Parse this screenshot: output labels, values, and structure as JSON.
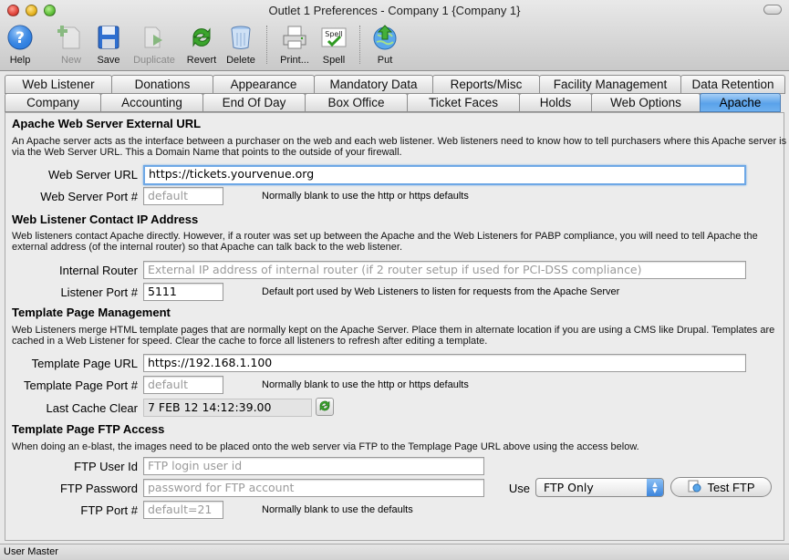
{
  "window": {
    "title": "Outlet 1 Preferences - Company 1 {Company 1}"
  },
  "toolbar": {
    "help": "Help",
    "new": "New",
    "save": "Save",
    "duplicate": "Duplicate",
    "revert": "Revert",
    "delete": "Delete",
    "print": "Print...",
    "spell": "Spell",
    "spell_icon_text": "Spell",
    "put": "Put"
  },
  "tabs": {
    "row1": [
      "Web Listener",
      "Donations",
      "Appearance",
      "Mandatory Data",
      "Reports/Misc",
      "Facility Management",
      "Data Retention"
    ],
    "row2": [
      "Company",
      "Accounting",
      "End Of Day",
      "Box Office",
      "Ticket Faces",
      "Holds",
      "Web Options",
      "Apache"
    ],
    "active": "Apache"
  },
  "apache": {
    "title": "Apache Web Server External URL",
    "desc": "An Apache server acts as the interface between a purchaser on the web and each web listener.  Web listeners need to know how to tell purchasers where this Apache server is via the Web Server URL.  This a Domain Name that points to the outside of your firewall.",
    "url_label": "Web Server URL",
    "url_value": "https://tickets.yourvenue.org",
    "port_label": "Web Server Port #",
    "port_placeholder": "default",
    "port_note": "Normally blank to use the http or https defaults"
  },
  "listener": {
    "title": "Web Listener Contact IP Address",
    "desc": "Web listeners contact Apache directly.  However, if a router was set up between the Apache and the Web Listeners for PABP compliance, you will need to tell Apache the external address (of the internal router) so that Apache can talk back to the web listener.",
    "router_label": "Internal Router",
    "router_placeholder": "External IP address of internal router (if 2 router setup if used for PCI-DSS compliance)",
    "port_label": "Listener Port #",
    "port_value": "5111",
    "port_note": "Default port used by Web Listeners to listen for requests from the Apache Server"
  },
  "template": {
    "title": "Template Page Management",
    "desc": "Web Listeners merge HTML template pages that are normally kept on the Apache Server.  Place them in alternate location if you are using a CMS like Drupal. Templates are cached in a Web Listener for speed.  Clear the cache to force all listeners to refresh after editing a template.",
    "url_label": "Template Page URL",
    "url_value": "https://192.168.1.100",
    "port_label": "Template Page Port #",
    "port_placeholder": "default",
    "port_note": "Normally blank to use the http or https defaults",
    "cache_label": "Last Cache Clear",
    "cache_value": "7 FEB 12  14:12:39.00"
  },
  "ftp": {
    "title": "Template Page FTP Access",
    "desc": "When doing an e-blast, the images need to be placed onto the web server via FTP to the Templage Page URL above using the access below.",
    "user_label": "FTP User Id",
    "user_placeholder": "FTP login user id",
    "password_label": "FTP Password",
    "password_placeholder": "password for FTP account",
    "use_label": "Use",
    "use_value": "FTP Only",
    "test_button": "Test FTP",
    "port_label": "FTP Port #",
    "port_placeholder": "default=21",
    "port_note": "Normally blank to use the defaults"
  },
  "status": {
    "user": "User Master"
  }
}
